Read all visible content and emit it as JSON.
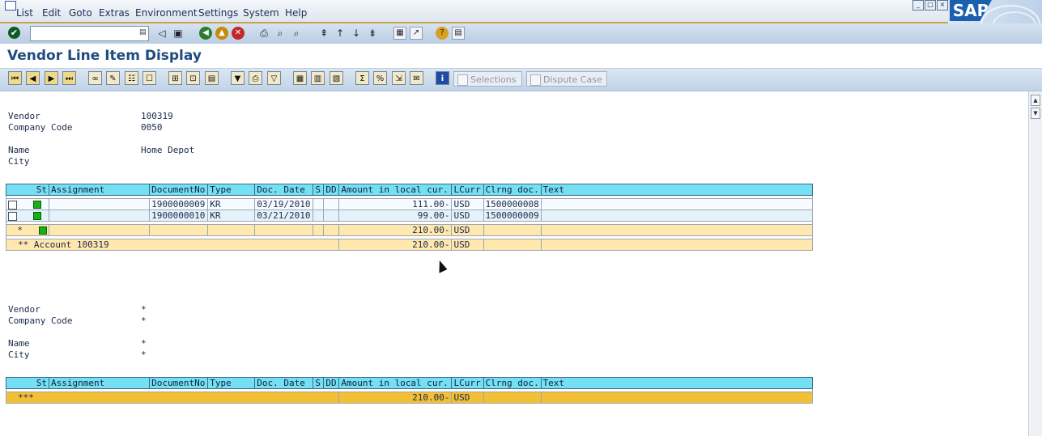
{
  "menu": [
    "List",
    "Edit",
    "Goto",
    "Extras",
    "Environment",
    "Settings",
    "System",
    "Help"
  ],
  "sap_logo": "SAP",
  "title": "Vendor Line Item Display",
  "toolbar": {
    "selections_label": "Selections",
    "dispute_label": "Dispute Case"
  },
  "header1": {
    "vendor_label": "Vendor",
    "vendor_value": "100319",
    "company_label": "Company Code",
    "company_value": "0050",
    "name_label": "Name",
    "name_value": "Home Depot",
    "city_label": "City",
    "city_value": ""
  },
  "columns": [
    "St",
    "Assignment",
    "DocumentNo",
    "Type",
    "Doc. Date",
    "S",
    "DD",
    "Amount in local cur.",
    "LCurr",
    "Clrng doc.",
    "Text"
  ],
  "rows": [
    {
      "assignment": "",
      "document_no": "1900000009",
      "type": "KR",
      "doc_date": "03/19/2010",
      "s": "",
      "dd": "",
      "amount": "111.00-",
      "lcurr": "USD",
      "clrng_doc": "1500000008",
      "text": ""
    },
    {
      "assignment": "",
      "document_no": "1900000010",
      "type": "KR",
      "doc_date": "03/21/2010",
      "s": "",
      "dd": "",
      "amount": "99.00-",
      "lcurr": "USD",
      "clrng_doc": "1500000009",
      "text": ""
    }
  ],
  "subtotal": {
    "marker": "*",
    "amount": "210.00-",
    "lcurr": "USD"
  },
  "account_total": {
    "label": "** Account 100319",
    "amount": "210.00-",
    "lcurr": "USD"
  },
  "header2": {
    "vendor_label": "Vendor",
    "vendor_value": "*",
    "company_label": "Company Code",
    "company_value": "*",
    "name_label": "Name",
    "name_value": "*",
    "city_label": "City",
    "city_value": "*"
  },
  "grand_total": {
    "label": "***",
    "amount": "210.00-",
    "lcurr": "USD"
  },
  "colors": {
    "header_cyan": "#75e0f4",
    "subtotal": "#ffe7ad",
    "grand_total": "#f3bf35",
    "status_green": "#15b215",
    "title_blue": "#1f4b7f"
  }
}
